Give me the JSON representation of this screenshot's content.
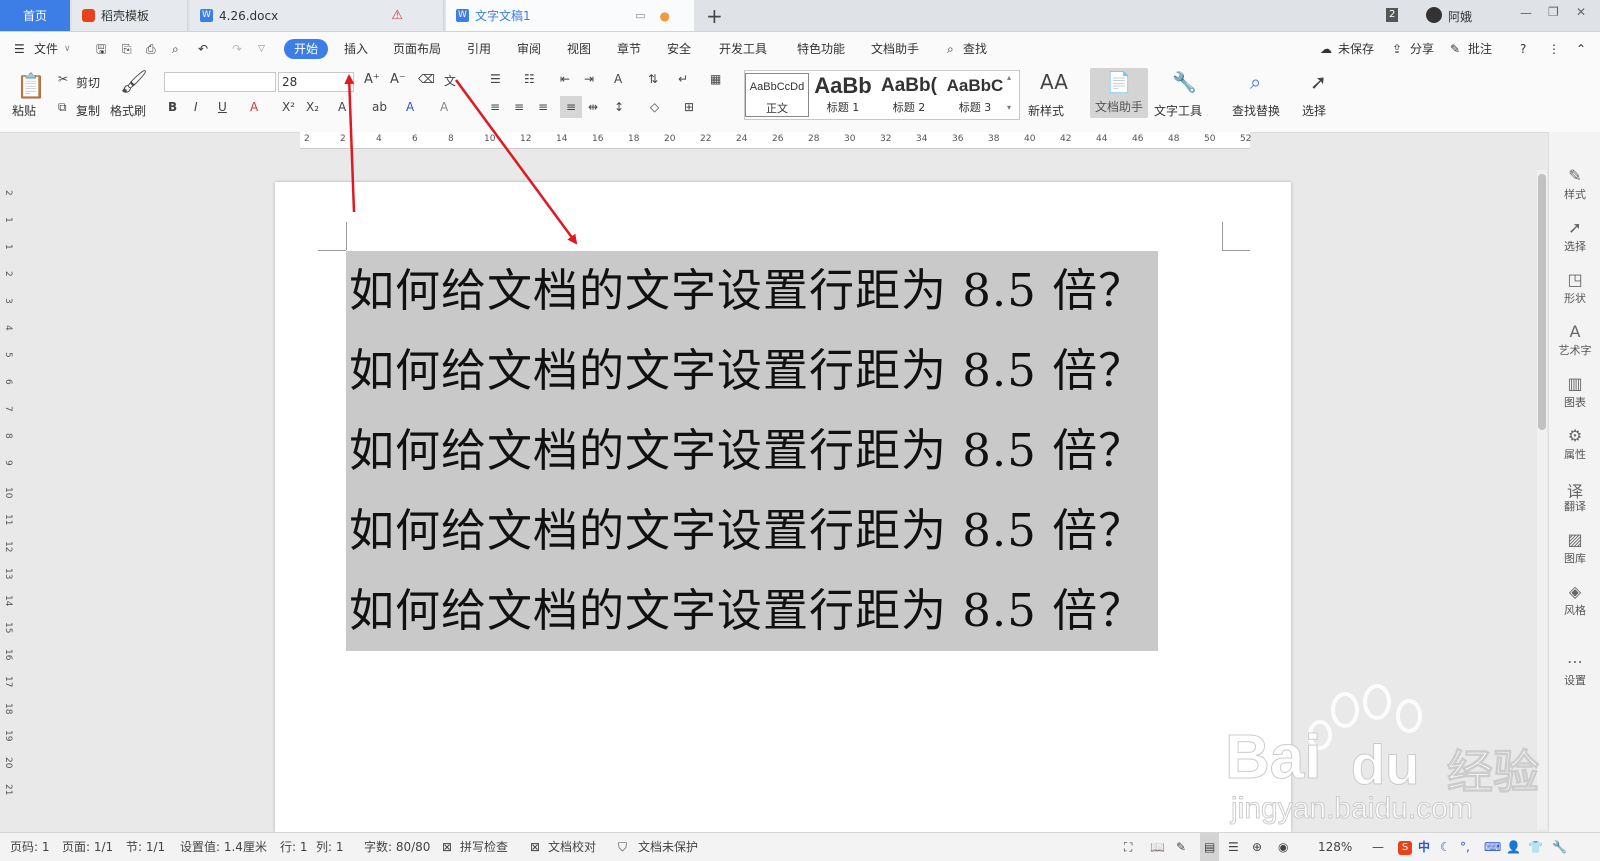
{
  "tabs": {
    "home": "首页",
    "template": "稻壳模板",
    "doc1": "4.26.docx",
    "doc2": "文字文稿1",
    "add": "+",
    "count": "2",
    "user": "阿娥"
  },
  "menu": {
    "file": "文件",
    "items": [
      "开始",
      "插入",
      "页面布局",
      "引用",
      "审阅",
      "视图",
      "章节",
      "安全",
      "开发工具",
      "特色功能",
      "文档助手"
    ],
    "search": "查找",
    "unsaved": "未保存",
    "share": "分享",
    "comment": "批注",
    "help": "?"
  },
  "ribbon": {
    "paste": "粘贴",
    "cut": "剪切",
    "copy": "复制",
    "format_painter": "格式刷",
    "font_name": "",
    "font_size": "28",
    "styles": [
      {
        "sample": "AaBbCcDd",
        "label": "正文"
      },
      {
        "sample": "AaBb",
        "label": "标题 1"
      },
      {
        "sample": "AaBb(",
        "label": "标题 2"
      },
      {
        "sample": "AaBbC",
        "label": "标题 3"
      }
    ],
    "new_style": "新样式",
    "doc_helper": "文档助手",
    "text_tools": "文字工具",
    "find_replace": "查找替换",
    "select": "选择"
  },
  "ruler": {
    "marks": [
      "2",
      "2",
      "4",
      "6",
      "8",
      "10",
      "12",
      "14",
      "16",
      "18",
      "20",
      "22",
      "24",
      "26",
      "28",
      "30",
      "32",
      "34",
      "36",
      "38",
      "40",
      "42",
      "44",
      "46",
      "48",
      "50",
      "52"
    ],
    "vmarks": [
      "2",
      "1",
      "1",
      "2",
      "3",
      "4",
      "5",
      "6",
      "7",
      "8",
      "9",
      "10",
      "11",
      "12",
      "13",
      "14",
      "15",
      "16",
      "17",
      "18",
      "19",
      "20",
      "21"
    ]
  },
  "document": {
    "lines": [
      "如何给文档的文字设置行距为 8.5 倍？",
      "如何给文档的文字设置行距为 8.5 倍？",
      "如何给文档的文字设置行距为 8.5 倍？",
      "如何给文档的文字设置行距为 8.5 倍？",
      "如何给文档的文字设置行距为 8.5 倍？"
    ]
  },
  "right_panel": [
    "样式",
    "选择",
    "形状",
    "艺术字",
    "图表",
    "属性",
    "翻译",
    "图库",
    "风格",
    "设置"
  ],
  "status": {
    "page_no": "页码: 1",
    "pages": "页面: 1/1",
    "section": "节: 1/1",
    "setting": "设置值: 1.4厘米",
    "row": "行: 1",
    "col": "列: 1",
    "words": "字数: 80/80",
    "spell": "拼写检查",
    "proof": "文档校对",
    "protect": "文档未保护",
    "zoom": "128%"
  },
  "watermark": {
    "brand": "Bai",
    "brand_cn": "经验",
    "url": "jingyan.baidu.com"
  },
  "colors": {
    "accent": "#3d7ee6",
    "selection": "#c9c9c9",
    "arrow": "#e0191f"
  }
}
